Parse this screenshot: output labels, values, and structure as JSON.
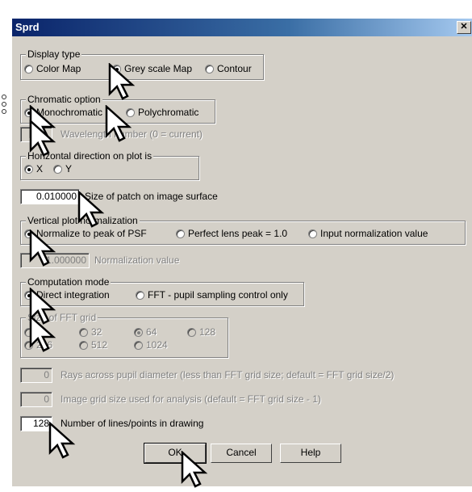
{
  "window": {
    "title": "Sprd",
    "close_glyph": "✕"
  },
  "display_type": {
    "legend": "Display type",
    "options": [
      {
        "label": "Color Map",
        "checked": false
      },
      {
        "label": "Grey scale Map",
        "checked": true
      },
      {
        "label": "Contour",
        "checked": false
      }
    ]
  },
  "chromatic": {
    "legend": "Chromatic option",
    "options": [
      {
        "label": "Monochromatic",
        "checked": true
      },
      {
        "label": "Polychromatic",
        "checked": false
      }
    ]
  },
  "wavelength": {
    "value": "",
    "label": "Wavelength number (0 = current)"
  },
  "horizontal": {
    "legend": "Horizontal direction on plot is",
    "options": [
      {
        "label": "X",
        "checked": true
      },
      {
        "label": "Y",
        "checked": false
      }
    ]
  },
  "patch": {
    "value": "0.010000",
    "label": "Size of patch on image surface"
  },
  "vertical": {
    "legend": "Vertical plot normalization",
    "options": [
      {
        "label": "Normalize to peak of PSF",
        "checked": true
      },
      {
        "label": "Perfect lens peak = 1.0",
        "checked": false
      },
      {
        "label": "Input normalization value",
        "checked": false
      }
    ]
  },
  "norm_value": {
    "value": "1.000000",
    "label": "Normalization value"
  },
  "computation": {
    "legend": "Computation mode",
    "options": [
      {
        "label": "Direct integration",
        "checked": true
      },
      {
        "label": "FFT - pupil sampling control only",
        "checked": false
      }
    ]
  },
  "fft_grid": {
    "legend": "Size of FFT grid",
    "options": [
      {
        "label": "16",
        "checked": false
      },
      {
        "label": "32",
        "checked": false
      },
      {
        "label": "64",
        "checked": true
      },
      {
        "label": "128",
        "checked": false
      },
      {
        "label": "256",
        "checked": false
      },
      {
        "label": "512",
        "checked": false
      },
      {
        "label": "1024",
        "checked": false
      }
    ]
  },
  "rays": {
    "value": "0",
    "label": "Rays across pupil diameter (less than FFT grid size; default = FFT grid size/2)"
  },
  "image_grid": {
    "value": "0",
    "label": "Image grid size used for analysis (default = FFT grid size - 1)"
  },
  "lines": {
    "value": "128",
    "label": "Number of lines/points in drawing"
  },
  "buttons": {
    "ok": "OK",
    "cancel": "Cancel",
    "help": "Help"
  },
  "colors": {
    "title_start": "#0a246a",
    "title_end": "#a6caf0",
    "face": "#d4d0c8"
  }
}
